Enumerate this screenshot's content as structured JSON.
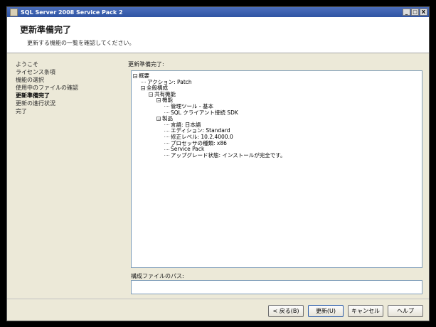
{
  "window": {
    "title": "SQL Server 2008 Service Pack 2",
    "controls": [
      "_",
      "□",
      "X"
    ]
  },
  "header": {
    "title": "更新準備完了",
    "subtitle": "更新する機能の一覧を確認してください。"
  },
  "nav": [
    "ようこそ",
    "ライセンス条項",
    "機能の選択",
    "使用中のファイルの確認",
    "更新準備完了",
    "更新の進行状況",
    "完了"
  ],
  "nav_active": 4,
  "content": {
    "tree_label": "更新準備完了:",
    "log_label": "構成ファイルのパス:"
  },
  "tree": [
    {
      "text": "概要",
      "level": 0,
      "box": "−"
    },
    {
      "text": "アクション: Patch",
      "level": 1,
      "box": ""
    },
    {
      "text": "全般構成",
      "level": 1,
      "box": "−"
    },
    {
      "text": "共有機能",
      "level": 2,
      "box": "−"
    },
    {
      "text": "機能",
      "level": 3,
      "box": "−"
    },
    {
      "text": "管理ツール - 基本",
      "level": 4,
      "box": ""
    },
    {
      "text": "SQL クライアント接続 SDK",
      "level": 4,
      "box": ""
    },
    {
      "text": "製品",
      "level": 3,
      "box": "−"
    },
    {
      "text": "言語: 日本語",
      "level": 4,
      "box": ""
    },
    {
      "text": "エディション: Standard",
      "level": 4,
      "box": ""
    },
    {
      "text": "修正レベル: 10.2.4000.0",
      "level": 4,
      "box": ""
    },
    {
      "text": "プロセッサの種類: x86",
      "level": 4,
      "box": ""
    },
    {
      "text": "Service Pack",
      "level": 4,
      "box": ""
    },
    {
      "text": "アップグレード状態: インストールが完全です。",
      "level": 4,
      "box": ""
    }
  ],
  "buttons": {
    "back": "< 戻る(B)",
    "update": "更新(U)",
    "cancel": "キャンセル",
    "help": "ヘルプ"
  }
}
